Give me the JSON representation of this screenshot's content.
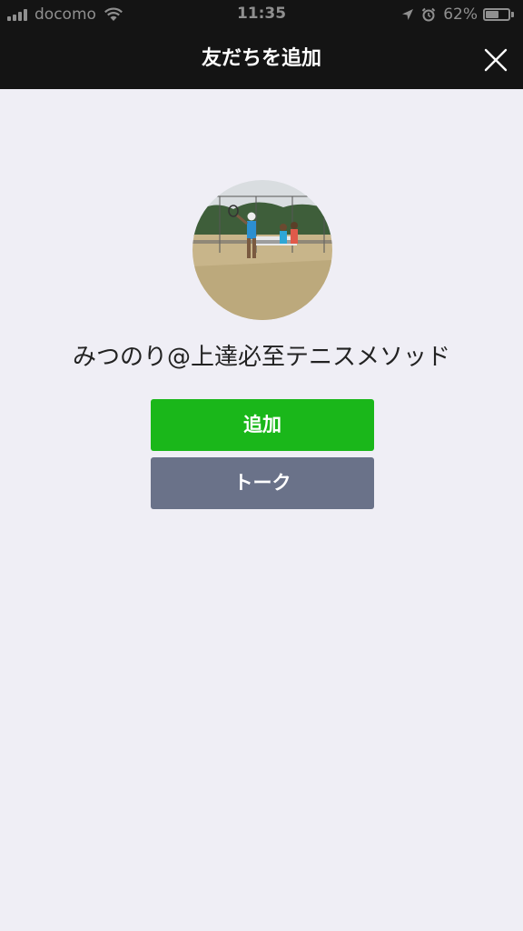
{
  "status_bar": {
    "carrier": "docomo",
    "time": "11:35",
    "battery_percent": "62%",
    "battery_level": 0.62,
    "icons": [
      "signal-icon",
      "wifi-icon",
      "location-icon",
      "alarm-icon",
      "battery-icon"
    ]
  },
  "header": {
    "title": "友だちを追加",
    "close_icon": "close-icon"
  },
  "profile": {
    "name": "みつのり@上達必至テニスメソッド",
    "avatar": "tennis-player-photo"
  },
  "actions": {
    "add_label": "追加",
    "talk_label": "トーク"
  },
  "colors": {
    "background": "#efeef5",
    "nav_bar": "#141414",
    "add_button": "#1ab71a",
    "talk_button": "#6a7289",
    "text": "#222222"
  }
}
